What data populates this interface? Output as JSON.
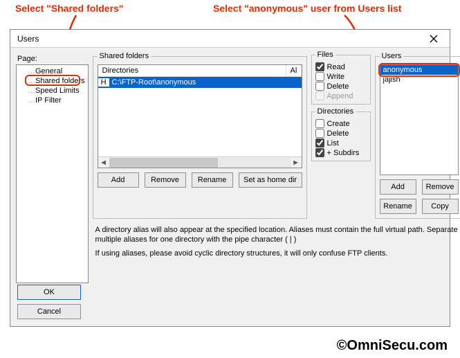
{
  "annotations": {
    "left": "Select  \"Shared folders\"",
    "right": "Select  \"anonymous\" user from Users list"
  },
  "watermark": "OmniSecu.com",
  "copyright": "©OmniSecu.com",
  "dialog": {
    "title": "Users",
    "page_label": "Page:",
    "tree": {
      "general": "General",
      "shared_folders": "Shared folders",
      "speed_limits": "Speed Limits",
      "ip_filter": "IP Filter"
    },
    "shared_folders": {
      "legend": "Shared folders",
      "col_directories": "Directories",
      "col_aliases": "Al",
      "row_h": "H",
      "row_path": "C:\\FTP-Root\\anonymous",
      "buttons": {
        "add": "Add",
        "remove": "Remove",
        "rename": "Rename",
        "sethome": "Set as home dir"
      }
    },
    "files": {
      "legend": "Files",
      "read": "Read",
      "write": "Write",
      "delete": "Delete",
      "append": "Append"
    },
    "dirs": {
      "legend": "Directories",
      "create": "Create",
      "delete": "Delete",
      "list": "List",
      "subdirs": "+ Subdirs"
    },
    "users": {
      "legend": "Users",
      "items": {
        "anonymous": "anonymous",
        "jajish": "jajish"
      },
      "buttons": {
        "add": "Add",
        "remove": "Remove",
        "rename": "Rename",
        "copy": "Copy"
      }
    },
    "help": {
      "line1": "A directory alias will also appear at the specified location. Aliases must contain the full virtual path. Separate multiple aliases for one directory with the pipe character ( | )",
      "line2": "If using aliases, please avoid cyclic directory structures, it will only confuse FTP clients."
    },
    "bottom": {
      "ok": "OK",
      "cancel": "Cancel"
    }
  }
}
